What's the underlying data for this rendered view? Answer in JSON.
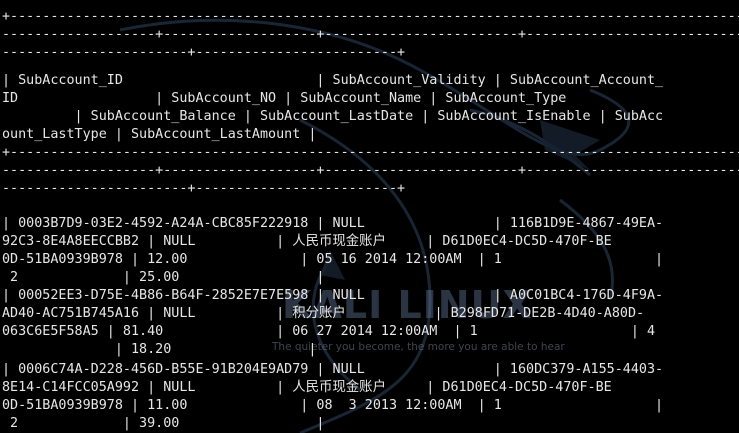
{
  "watermark": {
    "title": "KALI LINUX",
    "tagline": "The quieter you become, the more you are able to hear"
  },
  "terminal_lines": [
    "+-----------------------------------------------------------------------------------------------",
    "-------------------+-------------------+------------------------+------------------------------------",
    "-----------------------+-------------------------+",
    "| SubAccount_ID                        | SubAccount_Validity | SubAccount_Account_",
    "ID                 | SubAccount_NO | SubAccount_Name | SubAccount_Type",
    "         | SubAccount_Balance | SubAccount_LastDate | SubAccount_IsEnable | SubAcc",
    "ount_LastType | SubAccount_LastAmount |",
    "+-----------------------------------------------------------------------------------------------",
    "-------------------+-------------------+------------------------+------------------------------------",
    "-----------------------+-------------------------+",
    "| 0003B7D9-03E2-4592-A24A-CBC85F222918 | NULL                | 116B1D9E-4867-49EA-",
    "92C3-8E4A8EECCBB2 | NULL          | 人民币现金账户     | D61D0EC4-DC5D-470F-BE",
    "0D-51BA0939B978 | 12.00              | 05 16 2014 12:00AM  | 1                   |",
    " 2             | 25.00                 |",
    "| 00052EE3-D75E-4B86-B64F-2852E7E7E598 | NULL                | A0C01BC4-176D-4F9A-",
    "AD40-AC751B745A16 | NULL          | 积分账户           | B298FD71-DE2B-4D40-A80D-",
    "063C6E5F58A5 | 81.40              | 06 27 2014 12:00AM  | 1                   | 4",
    "              | 18.20                 |",
    "| 0006C74A-D228-456D-B55E-91B204E9AD79 | NULL                | 160DC379-A155-4403-",
    "8E14-C14FCC05A992 | NULL          | 人民币现金账户     | D61D0EC4-DC5D-470F-BE",
    "0D-51BA0939B978 | 11.00              | 08  3 2013 12:00AM  | 1                   |",
    " 2             | 39.00                 |"
  ]
}
